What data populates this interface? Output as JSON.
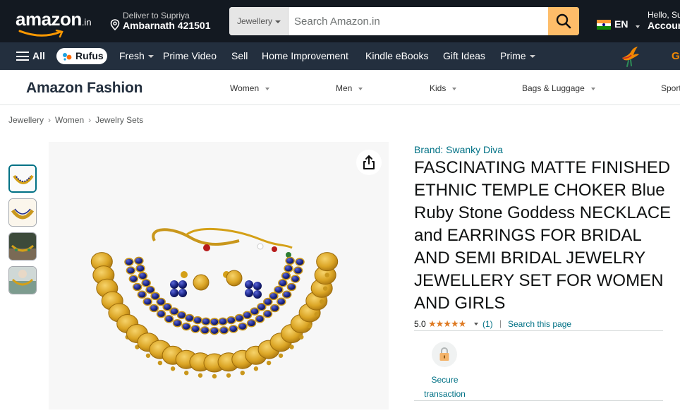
{
  "header": {
    "logo_text": "amazon",
    "logo_suffix": ".in",
    "deliver_line1": "Deliver to Supriya",
    "deliver_line2": "Ambarnath 421501",
    "search_category": "Jewellery",
    "search_placeholder": "Search Amazon.in",
    "language": "EN",
    "account_line1": "Hello, Su",
    "account_line2": "Accoun"
  },
  "subnav": {
    "all_label": "All",
    "rufus_label": "Rufus",
    "items": [
      "Fresh",
      "Prime Video",
      "Sell",
      "Home Improvement",
      "Kindle eBooks",
      "Gift Ideas",
      "Prime"
    ],
    "promo_letter": "G"
  },
  "fashion": {
    "title": "Amazon Fashion",
    "categories": [
      "Women",
      "Men",
      "Kids",
      "Bags & Luggage",
      "Sport"
    ]
  },
  "breadcrumb": [
    "Jewellery",
    "Women",
    "Jewelry Sets"
  ],
  "product": {
    "brand": "Brand: Swanky Diva",
    "title": "FASCINATING MATTE FINISHED ETHNIC TEMPLE CHOKER Blue Ruby Stone Goddess NECKLACE and EARRINGS FOR BRIDAL AND SEMI BRIDAL JEWELRY JEWELLERY SET FOR WOMEN AND GIRLS",
    "rating_value": "5.0",
    "rating_stars": 5,
    "rating_count": "(1)",
    "search_page": "Search this page",
    "secure_label": "Secure transaction"
  },
  "colors": {
    "nav_dark": "#131921",
    "nav_secondary": "#232f3e",
    "search_button": "#febd69",
    "link": "#007185",
    "star": "#de7921",
    "gold": "#d4a017",
    "stone_blue": "#1f2a8c"
  },
  "icons": [
    "location-pin-icon",
    "search-icon",
    "india-flag-icon",
    "hamburger-icon",
    "rufus-icon",
    "bird-icon",
    "share-icon",
    "lock-icon"
  ]
}
